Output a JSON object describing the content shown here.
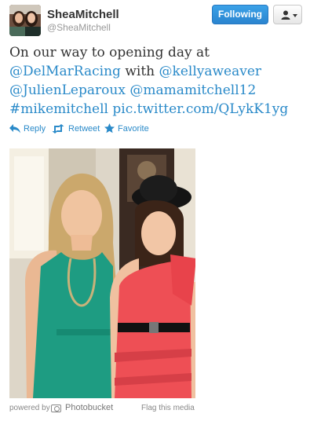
{
  "user": {
    "full_name": "SheaMitchell",
    "screen_name": "@SheaMitchell"
  },
  "header": {
    "follow_label": "Following"
  },
  "tweet": {
    "line1": "On our way to opening day at",
    "mention_delmar": "@DelMarRacing",
    "word_with": "with",
    "mention_kelly": "@kellyaweaver",
    "mention_julien": "@JulienLeparoux",
    "mention_mama": "@mamamitchell12",
    "hashtag_mike": "#mikemitchell",
    "media_link": "pic.twitter.com/QLykK1yg"
  },
  "actions": {
    "reply": "Reply",
    "retweet": "Retweet",
    "favorite": "Favorite"
  },
  "footer": {
    "powered_by": "powered by",
    "provider": "Photobucket",
    "flag": "Flag this media"
  },
  "colors": {
    "link": "#2a8ac9",
    "follow_button": "#2a84cf"
  }
}
